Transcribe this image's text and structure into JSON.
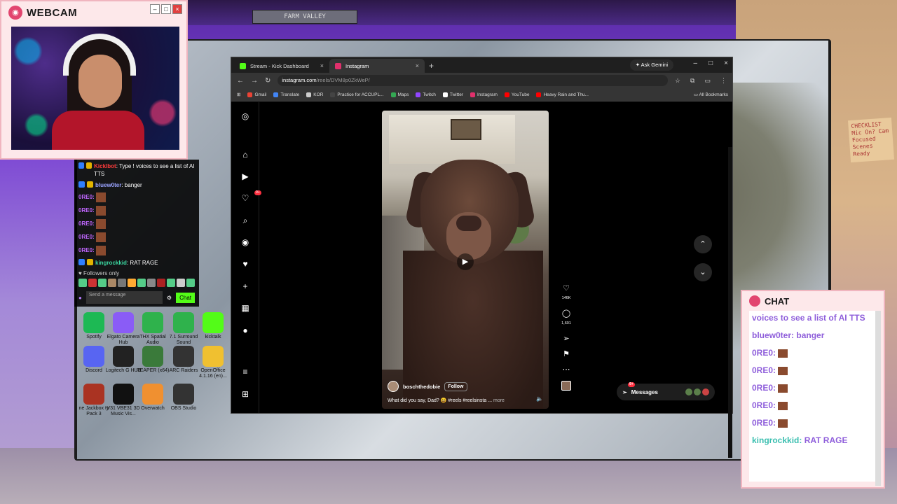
{
  "webcam": {
    "title": "WEBCAM"
  },
  "background": {
    "shelf_label": "FARM VALLEY",
    "note_text": "CHECKLIST Mic On? Cam Focused Scenes Ready"
  },
  "desktop_icons": [
    {
      "label": "Spotify",
      "color": "#1db954"
    },
    {
      "label": "Elgato Camera Hub",
      "color": "#8a5cf6"
    },
    {
      "label": "THX Spatial Audio",
      "color": "#2fb24c"
    },
    {
      "label": "7.1 Surround Sound",
      "color": "#2fb24c"
    },
    {
      "label": "kicktalk",
      "color": "#53fc18"
    },
    {
      "label": "Discord",
      "color": "#5865f2"
    },
    {
      "label": "Logitech G HUB",
      "color": "#222222"
    },
    {
      "label": "REAPER (x64)",
      "color": "#3a7a3a"
    },
    {
      "label": "ARC Raiders",
      "color": "#333333"
    },
    {
      "label": "OpenOffice 4.1.16 (en)...",
      "color": "#f0c030"
    },
    {
      "label": "ne Jackbox ty Pack 3",
      "color": "#aa3322"
    },
    {
      "label": "V31 VBE31 3D Music Vis...",
      "color": "#111111"
    },
    {
      "label": "Overwatch",
      "color": "#f09030"
    },
    {
      "label": "OBS Studio",
      "color": "#333333"
    }
  ],
  "side_chat": {
    "messages": [
      {
        "name": "Kicklbot",
        "text": ": Type ! voices to see a list of AI TTS",
        "color": "#ff3b3b"
      },
      {
        "name": "bluew0ter",
        "text": ": banger",
        "color": "#9aa3ff"
      },
      {
        "name": "0RE0:",
        "text": "",
        "color": "#c066ff"
      },
      {
        "name": "0RE0:",
        "text": "",
        "color": "#c066ff"
      },
      {
        "name": "0RE0:",
        "text": "",
        "color": "#c066ff"
      },
      {
        "name": "0RE0:",
        "text": "",
        "color": "#c066ff"
      },
      {
        "name": "0RE0:",
        "text": "",
        "color": "#c066ff"
      },
      {
        "name": "kingrockkid",
        "text": ": RAT RAGE",
        "color": "#3bd6a0"
      }
    ],
    "followers_only": "Followers only",
    "input_placeholder": "Send a message",
    "chat_button": "Chat"
  },
  "browser": {
    "tabs": [
      {
        "label": "Stream - Kick Dashboard",
        "color": "#53fc18"
      },
      {
        "label": "Instagram",
        "color": "#e1306c"
      }
    ],
    "gemini": "Ask Gemini",
    "url_domain": "instagram.com",
    "url_path": "/reels/DVM8p0ZkWeP/",
    "bookmarks": [
      {
        "label": "Gmail",
        "color": "#ea4335"
      },
      {
        "label": "Translate",
        "color": "#4285f4"
      },
      {
        "label": "KOR",
        "color": "#cccccc"
      },
      {
        "label": "Practice for ACCUPL...",
        "color": "#444444"
      },
      {
        "label": "Maps",
        "color": "#34a853"
      },
      {
        "label": "Twitch",
        "color": "#9146ff"
      },
      {
        "label": "Twitter",
        "color": "#ffffff"
      },
      {
        "label": "Instagram",
        "color": "#e1306c"
      },
      {
        "label": "YouTube",
        "color": "#ff0000"
      },
      {
        "label": "Heavy Rain and Thu...",
        "color": "#ff0000"
      }
    ],
    "all_bookmarks": "All Bookmarks"
  },
  "instagram": {
    "nav_badge": "9+",
    "author": "boschthedobie",
    "follow": "Follow",
    "caption": "What did you say, Dad? 😄 #reels #reelsinsta ...",
    "more": "more",
    "likes": "146K",
    "comments": "1,601",
    "messages_label": "Messages",
    "messages_badge": "9+"
  },
  "chat_overlay": {
    "title": "CHAT",
    "lines": [
      {
        "user": "",
        "text": "voices to see a list of AI TTS"
      },
      {
        "user": "bluew0ter:",
        "text": "banger"
      },
      {
        "user": "0RE0:",
        "text": ""
      },
      {
        "user": "0RE0:",
        "text": ""
      },
      {
        "user": "0RE0:",
        "text": ""
      },
      {
        "user": "0RE0:",
        "text": ""
      },
      {
        "user": "0RE0:",
        "text": ""
      },
      {
        "user": "kingrockkid:",
        "text": "RAT RAGE"
      }
    ]
  }
}
